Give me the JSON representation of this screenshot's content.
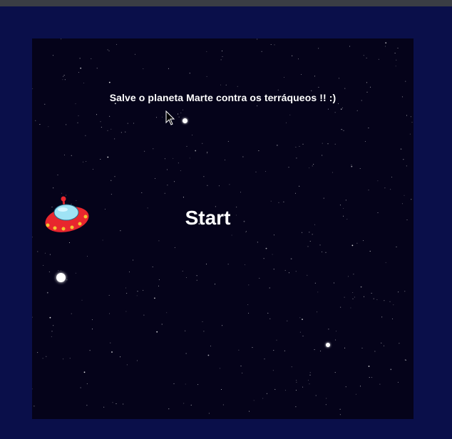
{
  "game": {
    "message": "Salve o planeta Marte contra os terráqueos !! :)",
    "start_label": "Start"
  },
  "colors": {
    "page_background": "#0a0f4a",
    "game_background": "#05031a",
    "top_bar": "#3a3d44",
    "ufo_body": "#e8262e",
    "ufo_dome": "#9fe3f5",
    "ufo_lights": "#f4c430",
    "text": "#ffffff"
  },
  "icons": {
    "player": "ufo-icon",
    "pointer": "mouse-cursor-icon"
  }
}
